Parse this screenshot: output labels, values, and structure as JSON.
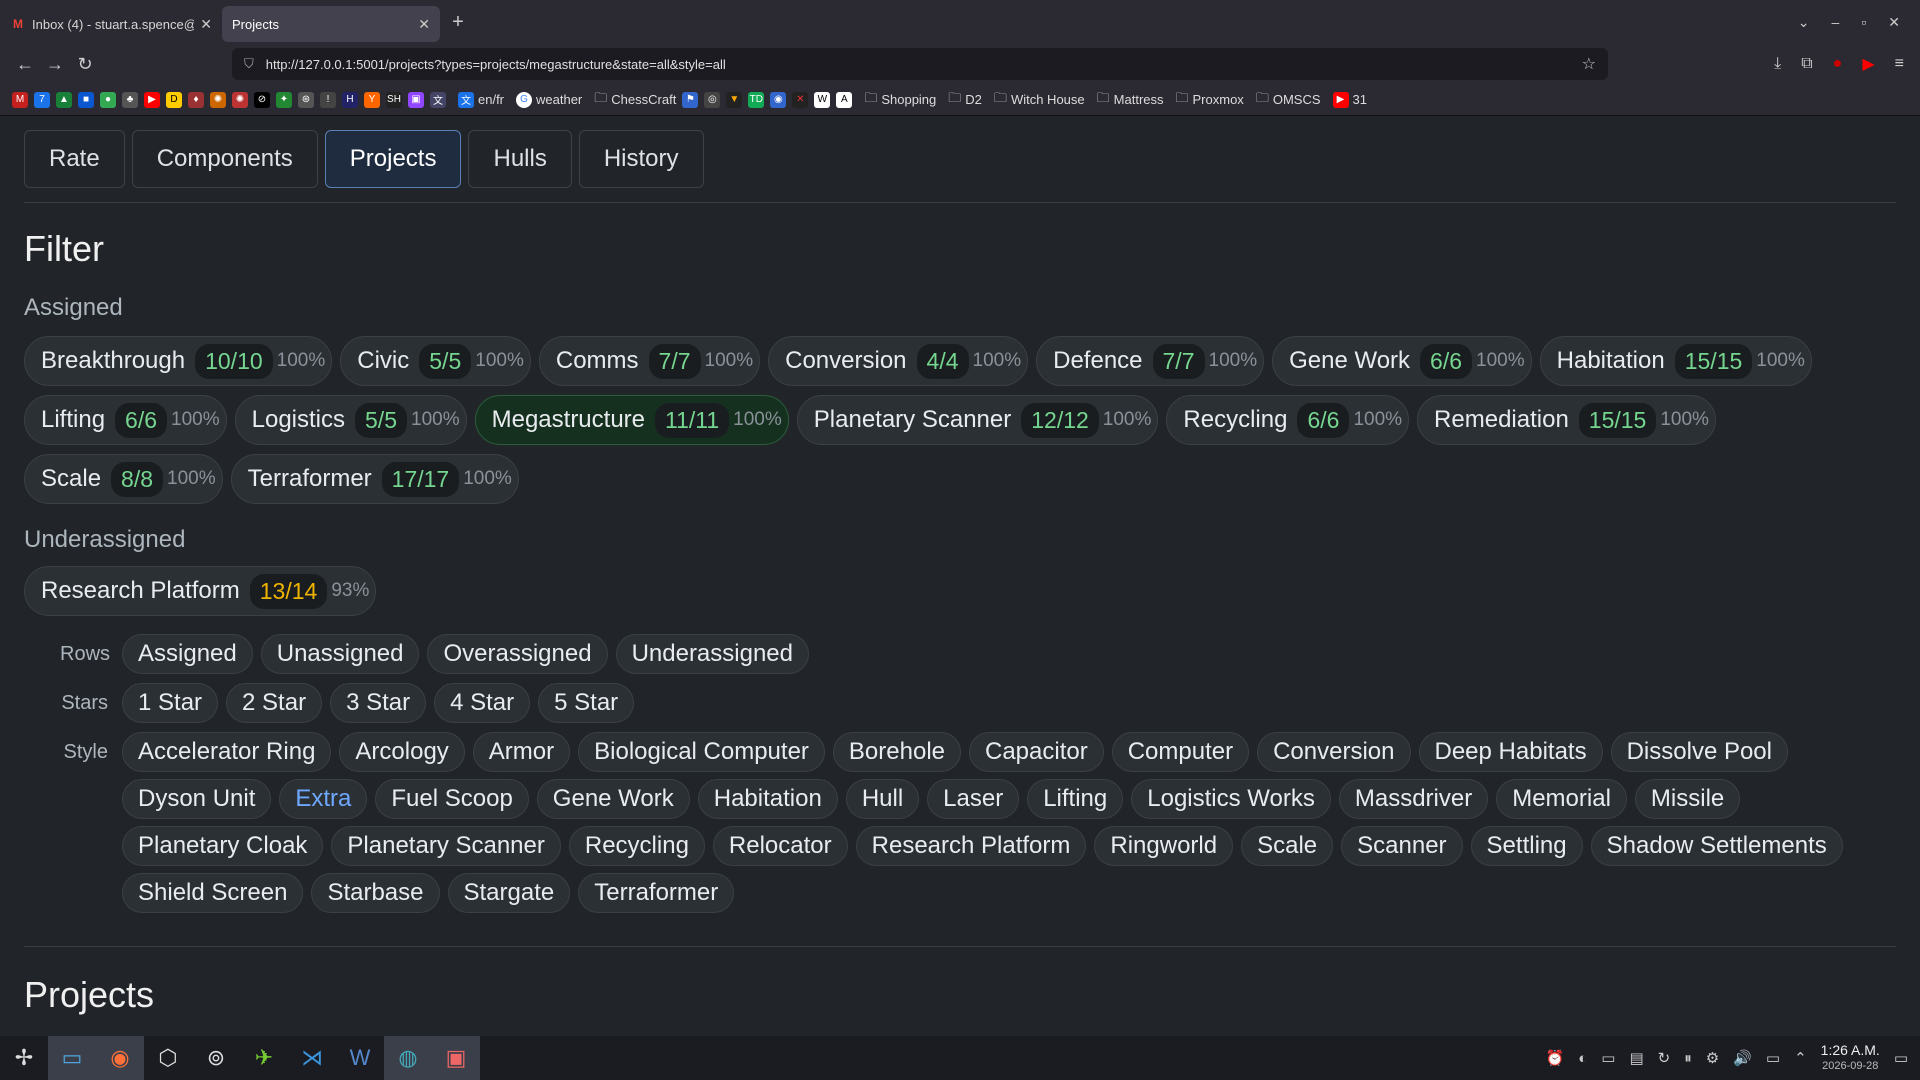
{
  "browser": {
    "tabs": [
      {
        "title": "Inbox (4) - stuart.a.spence@",
        "favicon": "gmail-icon",
        "active": false
      },
      {
        "title": "Projects",
        "favicon": "",
        "active": true
      }
    ],
    "url": "http://127.0.0.1:5001/projects?types=projects/megastructure&state=all&style=all",
    "bookmarks": [
      {
        "label": "en/fr"
      },
      {
        "label": "weather"
      },
      {
        "label": "ChessCraft"
      },
      {
        "label": "Shopping"
      },
      {
        "label": "D2"
      },
      {
        "label": "Witch House"
      },
      {
        "label": "Mattress"
      },
      {
        "label": "Proxmox"
      },
      {
        "label": "OMSCS"
      },
      {
        "label": "31"
      }
    ]
  },
  "nav": {
    "tabs": [
      {
        "label": "Rate"
      },
      {
        "label": "Components"
      },
      {
        "label": "Projects",
        "active": true
      },
      {
        "label": "Hulls"
      },
      {
        "label": "History"
      }
    ]
  },
  "filter": {
    "title": "Filter",
    "assigned_label": "Assigned",
    "assigned": [
      {
        "name": "Breakthrough",
        "count": "10/10",
        "pct": "100%"
      },
      {
        "name": "Civic",
        "count": "5/5",
        "pct": "100%"
      },
      {
        "name": "Comms",
        "count": "7/7",
        "pct": "100%"
      },
      {
        "name": "Conversion",
        "count": "4/4",
        "pct": "100%"
      },
      {
        "name": "Defence",
        "count": "7/7",
        "pct": "100%"
      },
      {
        "name": "Gene Work",
        "count": "6/6",
        "pct": "100%"
      },
      {
        "name": "Habitation",
        "count": "15/15",
        "pct": "100%"
      },
      {
        "name": "Lifting",
        "count": "6/6",
        "pct": "100%"
      },
      {
        "name": "Logistics",
        "count": "5/5",
        "pct": "100%"
      },
      {
        "name": "Megastructure",
        "count": "11/11",
        "pct": "100%",
        "selected": true
      },
      {
        "name": "Planetary Scanner",
        "count": "12/12",
        "pct": "100%"
      },
      {
        "name": "Recycling",
        "count": "6/6",
        "pct": "100%"
      },
      {
        "name": "Remediation",
        "count": "15/15",
        "pct": "100%"
      },
      {
        "name": "Scale",
        "count": "8/8",
        "pct": "100%"
      },
      {
        "name": "Terraformer",
        "count": "17/17",
        "pct": "100%"
      }
    ],
    "underassigned_label": "Underassigned",
    "underassigned": [
      {
        "name": "Research Platform",
        "count": "13/14",
        "pct": "93%"
      }
    ],
    "rows_label": "Rows",
    "rows": [
      "Assigned",
      "Unassigned",
      "Overassigned",
      "Underassigned"
    ],
    "stars_label": "Stars",
    "stars": [
      "1 Star",
      "2 Star",
      "3 Star",
      "4 Star",
      "5 Star"
    ],
    "style_label": "Style",
    "styles": [
      "Accelerator Ring",
      "Arcology",
      "Armor",
      "Biological Computer",
      "Borehole",
      "Capacitor",
      "Computer",
      "Conversion",
      "Deep Habitats",
      "Dissolve Pool",
      "Dyson Unit",
      "Extra",
      "Fuel Scoop",
      "Gene Work",
      "Habitation",
      "Hull",
      "Laser",
      "Lifting",
      "Logistics Works",
      "Massdriver",
      "Memorial",
      "Missile",
      "Planetary Cloak",
      "Planetary Scanner",
      "Recycling",
      "Relocator",
      "Research Platform",
      "Ringworld",
      "Scale",
      "Scanner",
      "Settling",
      "Shadow Settlements",
      "Shield Screen",
      "Starbase",
      "Stargate",
      "Terraformer"
    ],
    "style_highlighted": "Extra"
  },
  "projects": {
    "title": "Projects"
  },
  "taskbar": {
    "time": "1:26 A.M.",
    "date": "2026-09-28"
  },
  "colors": {
    "accent_green": "#75d68f",
    "warn": "#f0b400",
    "link": "#6ea8fe"
  }
}
